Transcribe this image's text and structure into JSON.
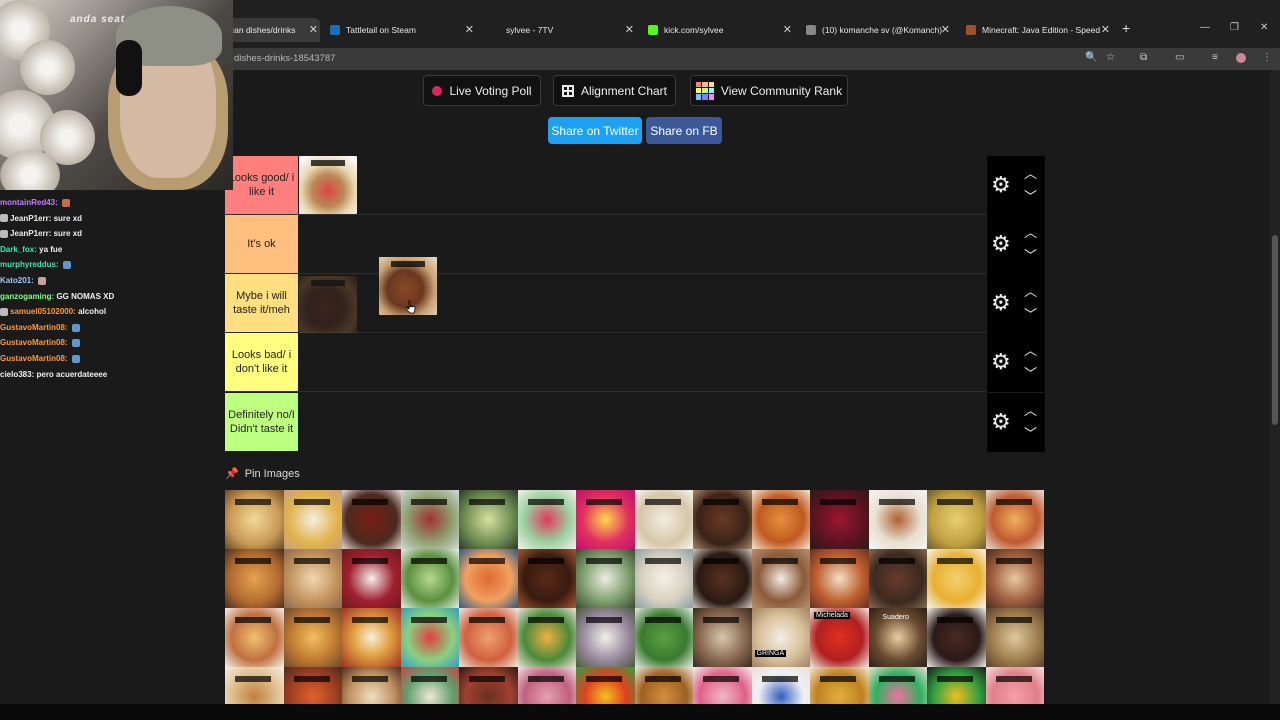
{
  "browser": {
    "tabs": [
      {
        "title": "ican dishes/drinks",
        "active": true,
        "icon": "tiermaker-icon"
      },
      {
        "title": "Tattletail on Steam",
        "icon": "steam-icon"
      },
      {
        "title": "sylvee - 7TV",
        "icon": "7tv-icon"
      },
      {
        "title": "kick.com/sylvee",
        "icon": "kick-icon"
      },
      {
        "title": "(10) komanche sv (@Komanch)",
        "icon": "x-icon"
      },
      {
        "title": "Minecraft: Java Edition - Speed",
        "icon": "speedrun-icon"
      }
    ],
    "url": "dishes-drinks-18543787"
  },
  "toolbar": {
    "live_poll": "Live Voting Poll",
    "alignment": "Alignment Chart",
    "community": "View Community Rank",
    "share_twitter": "Share on Twitter",
    "share_fb": "Share on FB"
  },
  "tiers": [
    {
      "label": "Looks good/ i like it",
      "color": "#ff7f7f"
    },
    {
      "label": "It's ok",
      "color": "#ffbf7f"
    },
    {
      "label": "Mybe i will taste it/meh",
      "color": "#ffdf7f"
    },
    {
      "label": "Looks bad/ i don't like it",
      "color": "#ffff7f"
    },
    {
      "label": "Definitely no/I Didn't taste it",
      "color": "#bfff7f"
    }
  ],
  "pin": {
    "label": "Pin Images"
  },
  "stream": {
    "overlay_text": "anda seat",
    "chat": [
      {
        "user": "montainRed43:",
        "text": "",
        "color": "#c77dff"
      },
      {
        "user": "JeanP1err:",
        "text": "sure xd",
        "color": "#f0f0f0"
      },
      {
        "user": "JeanP1err:",
        "text": "sure xd",
        "color": "#f0f0f0"
      },
      {
        "user": "Dark_fox:",
        "text": "ya fue",
        "color": "#3ee6b0"
      },
      {
        "user": "murphyreddus:",
        "text": "",
        "color": "#3ee6b0"
      },
      {
        "user": "Kato201:",
        "text": "",
        "color": "#9ec6ff"
      },
      {
        "user": "ganzogaming:",
        "text": "GG NOMAS XD",
        "color": "#7fff7f"
      },
      {
        "user": "samuel05102000:",
        "text": "alcohol",
        "color": "#ff9a3c"
      },
      {
        "user": "GustavoMartin08:",
        "text": "",
        "color": "#ff9a3c"
      },
      {
        "user": "GustavoMartin08:",
        "text": "",
        "color": "#ff9a3c"
      },
      {
        "user": "GustavoMartin08:",
        "text": "",
        "color": "#ff9a3c"
      },
      {
        "user": "cielo383:",
        "text": "pero acuerdateeee",
        "color": "#f0f0f0"
      }
    ]
  },
  "gallery_overlays": {
    "michelada": "Michelada",
    "suadero": "Suadero",
    "gringa": "GRINGA"
  }
}
